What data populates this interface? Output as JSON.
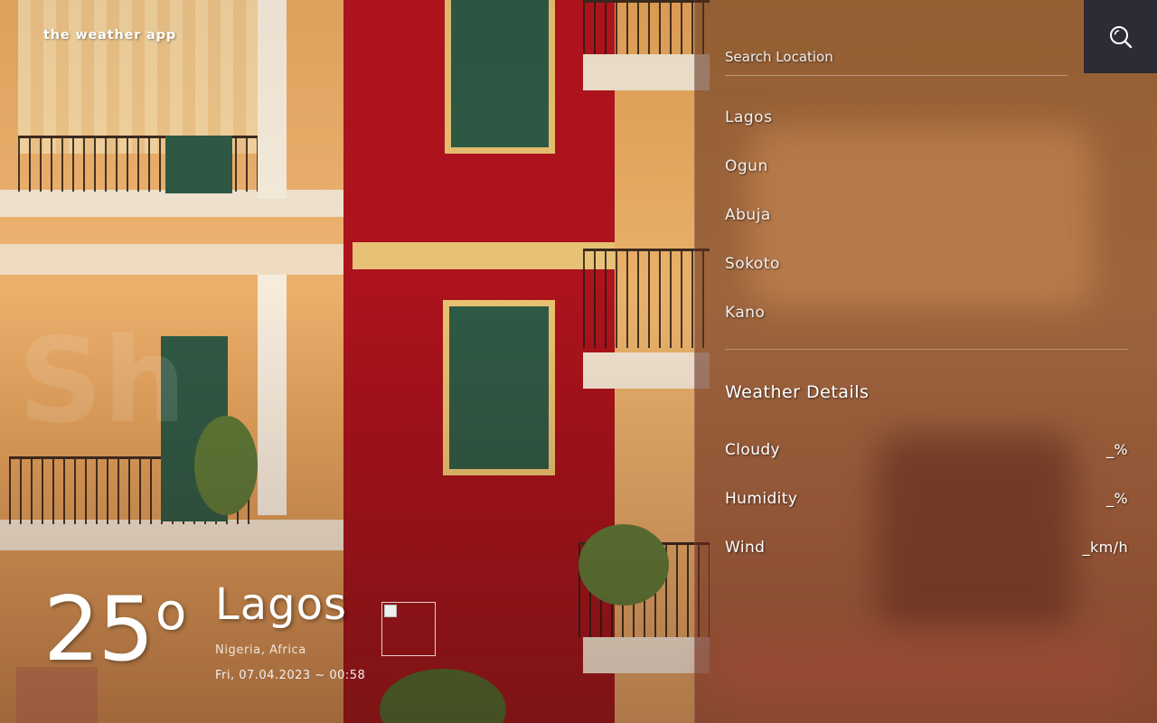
{
  "brand": {
    "name": "the weather app"
  },
  "current": {
    "temperature": "25",
    "degree_symbol": "o",
    "city": "Lagos",
    "region": "Nigeria, Africa",
    "datetime": "Fri, 07.04.2023 ~ 00:58"
  },
  "search": {
    "placeholder": "Search Location",
    "icon": "search-icon"
  },
  "cities": [
    "Lagos",
    "Ogun",
    "Abuja",
    "Sokoto",
    "Kano"
  ],
  "details": {
    "title": "Weather Details",
    "rows": [
      {
        "label": "Cloudy",
        "value": "_%"
      },
      {
        "label": "Humidity",
        "value": "_%"
      },
      {
        "label": "Wind",
        "value": "_km/h"
      }
    ]
  },
  "colors": {
    "search_button": "#2e2a36",
    "panel_tint": "#6e281e"
  }
}
